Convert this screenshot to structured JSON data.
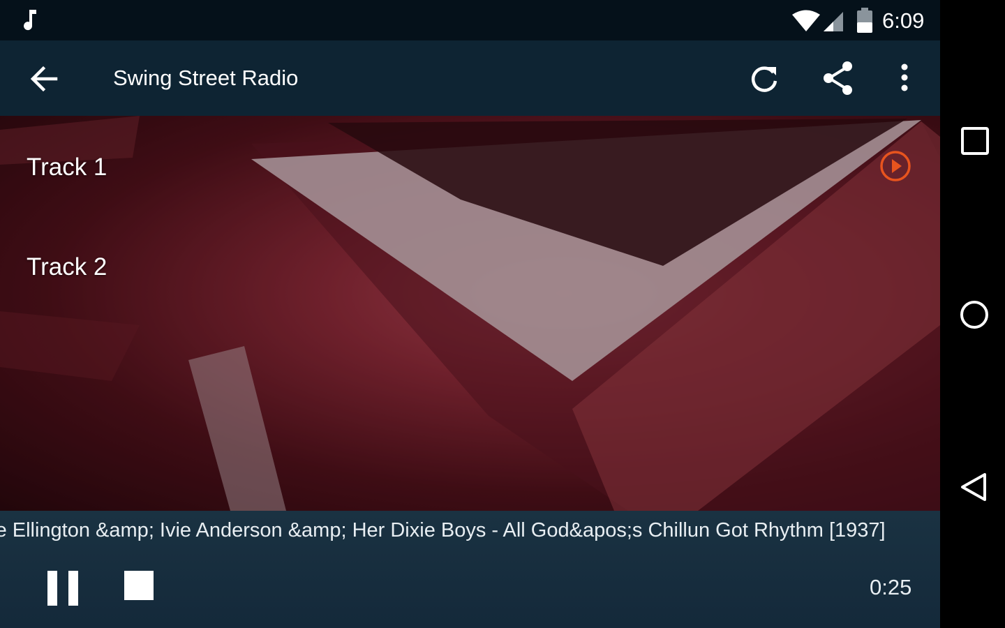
{
  "status_bar": {
    "time": "6:09",
    "icons": [
      "music-note-icon",
      "wifi-icon",
      "cell-signal-icon",
      "battery-icon"
    ]
  },
  "toolbar": {
    "title": "Swing Street Radio",
    "icons": [
      "back-arrow-icon",
      "refresh-icon",
      "share-icon",
      "more-vert-icon"
    ]
  },
  "tracks": [
    {
      "label": "Track 1",
      "playing": true
    },
    {
      "label": "Track 2",
      "playing": false
    }
  ],
  "player": {
    "now_playing": "Duke Ellington &amp; Ivie Anderson &amp; Her Dixie Boys - All God&apos;s Chillun Got Rhythm [1937]",
    "elapsed": "0:25",
    "icons": [
      "pause-icon",
      "stop-icon"
    ]
  },
  "navbar": {
    "icons": [
      "recents-icon",
      "home-icon",
      "back-triangle-icon"
    ]
  },
  "colors": {
    "status_bar": "#05111a",
    "toolbar": "#0e2433",
    "player_bar": "#14293a",
    "accent": "#e8541e",
    "image_tint": "#8a2a38"
  }
}
